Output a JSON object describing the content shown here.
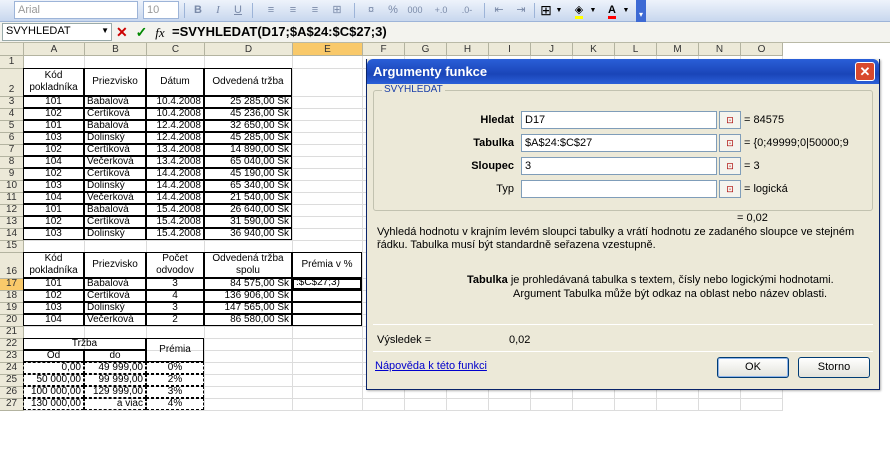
{
  "toolbar": {
    "font_name": "Arial",
    "font_size": "10",
    "bold": "B",
    "italic": "I",
    "underline": "U",
    "percent": "%",
    "thousands": "000",
    "font_color_letter": "A"
  },
  "formula_bar": {
    "name_box": "SVYHLEDAT",
    "cancel": "✕",
    "enter": "✓",
    "fx": "fx",
    "formula": "=SVYHLEDAT(D17;$A$24:$C$27;3)"
  },
  "columns": [
    "A",
    "B",
    "C",
    "D",
    "E",
    "F",
    "G",
    "H",
    "I",
    "J",
    "K",
    "L",
    "M",
    "N",
    "O"
  ],
  "rows": [
    "1",
    "2",
    "3",
    "4",
    "5",
    "6",
    "7",
    "8",
    "9",
    "10",
    "11",
    "12",
    "13",
    "14",
    "15",
    "16",
    "17",
    "18",
    "19",
    "20",
    "21",
    "22",
    "23",
    "24",
    "25",
    "26",
    "27"
  ],
  "table1": {
    "headers": [
      "Kód pokladníka",
      "Priezvisko",
      "Dátum",
      "Odvedená tržba"
    ],
    "rows": [
      [
        "101",
        "Babalová",
        "10.4.2008",
        "25 285,00 Sk"
      ],
      [
        "102",
        "Čertíková",
        "10.4.2008",
        "45 236,00 Sk"
      ],
      [
        "101",
        "Babalová",
        "12.4.2008",
        "32 650,00 Sk"
      ],
      [
        "103",
        "Dolinský",
        "12.4.2008",
        "45 285,00 Sk"
      ],
      [
        "102",
        "Čertíková",
        "13.4.2008",
        "14 890,00 Sk"
      ],
      [
        "104",
        "Večerková",
        "13.4.2008",
        "65 040,00 Sk"
      ],
      [
        "102",
        "Čertíková",
        "14.4.2008",
        "45 190,00 Sk"
      ],
      [
        "103",
        "Dolinský",
        "14.4.2008",
        "65 340,00 Sk"
      ],
      [
        "104",
        "Večerková",
        "14.4.2008",
        "21 540,00 Sk"
      ],
      [
        "101",
        "Babalová",
        "15.4.2008",
        "26 640,00 Sk"
      ],
      [
        "102",
        "Čertíková",
        "15.4.2008",
        "31 590,00 Sk"
      ],
      [
        "103",
        "Dolinský",
        "15.4.2008",
        "36 940,00 Sk"
      ]
    ]
  },
  "table2": {
    "headers": [
      "Kód pokladníka",
      "Priezvisko",
      "Počet odvodov",
      "Odvedená tržba spolu",
      "Prémia v %"
    ],
    "rows": [
      [
        "101",
        "Babalová",
        "3",
        "84 575,00 Sk",
        ":$C$27;3)"
      ],
      [
        "102",
        "Čertíková",
        "4",
        "136 906,00 Sk",
        ""
      ],
      [
        "103",
        "Dolinský",
        "3",
        "147 565,00 Sk",
        ""
      ],
      [
        "104",
        "Večerková",
        "2",
        "86 580,00 Sk",
        ""
      ]
    ]
  },
  "table3": {
    "header_trzba": "Tržba",
    "header_od": "Od",
    "header_do": "do",
    "header_premia": "Prémia",
    "rows": [
      [
        "0,00",
        "49 999,00",
        "0%"
      ],
      [
        "50 000,00",
        "99 999,00",
        "2%"
      ],
      [
        "100 000,00",
        "129 999,00",
        "3%"
      ],
      [
        "130 000,00",
        "a viac",
        "4%"
      ]
    ]
  },
  "dialog": {
    "title": "Argumenty funkce",
    "close": "✕",
    "group_label": "SVYHLEDAT",
    "args": [
      {
        "label": "Hledat",
        "value": "D17",
        "result": "= 84575"
      },
      {
        "label": "Tabulka",
        "value": "$A$24:$C$27",
        "result": "= {0;49999;0|50000;9"
      },
      {
        "label": "Sloupec",
        "value": "3",
        "result": "= 3"
      },
      {
        "label": "Typ",
        "value": "",
        "result": "= logická"
      }
    ],
    "result_preview": "= 0,02",
    "description": "Vyhledá hodnotu v krajním levém sloupci tabulky a vrátí hodnotu ze zadaného sloupce ve stejném řádku. Tabulka musí být standardně seřazena vzestupně.",
    "arg_help_name": "Tabulka",
    "arg_help_text1": " je prohledávaná tabulka s textem, čísly nebo logickými hodnotami.",
    "arg_help_text2": "Argument Tabulka může být odkaz na oblast nebo název oblasti.",
    "result_label": "Výsledek =",
    "result_value": "0,02",
    "help_link": "Nápověda k této funkci",
    "ok": "OK",
    "cancel": "Storno"
  }
}
